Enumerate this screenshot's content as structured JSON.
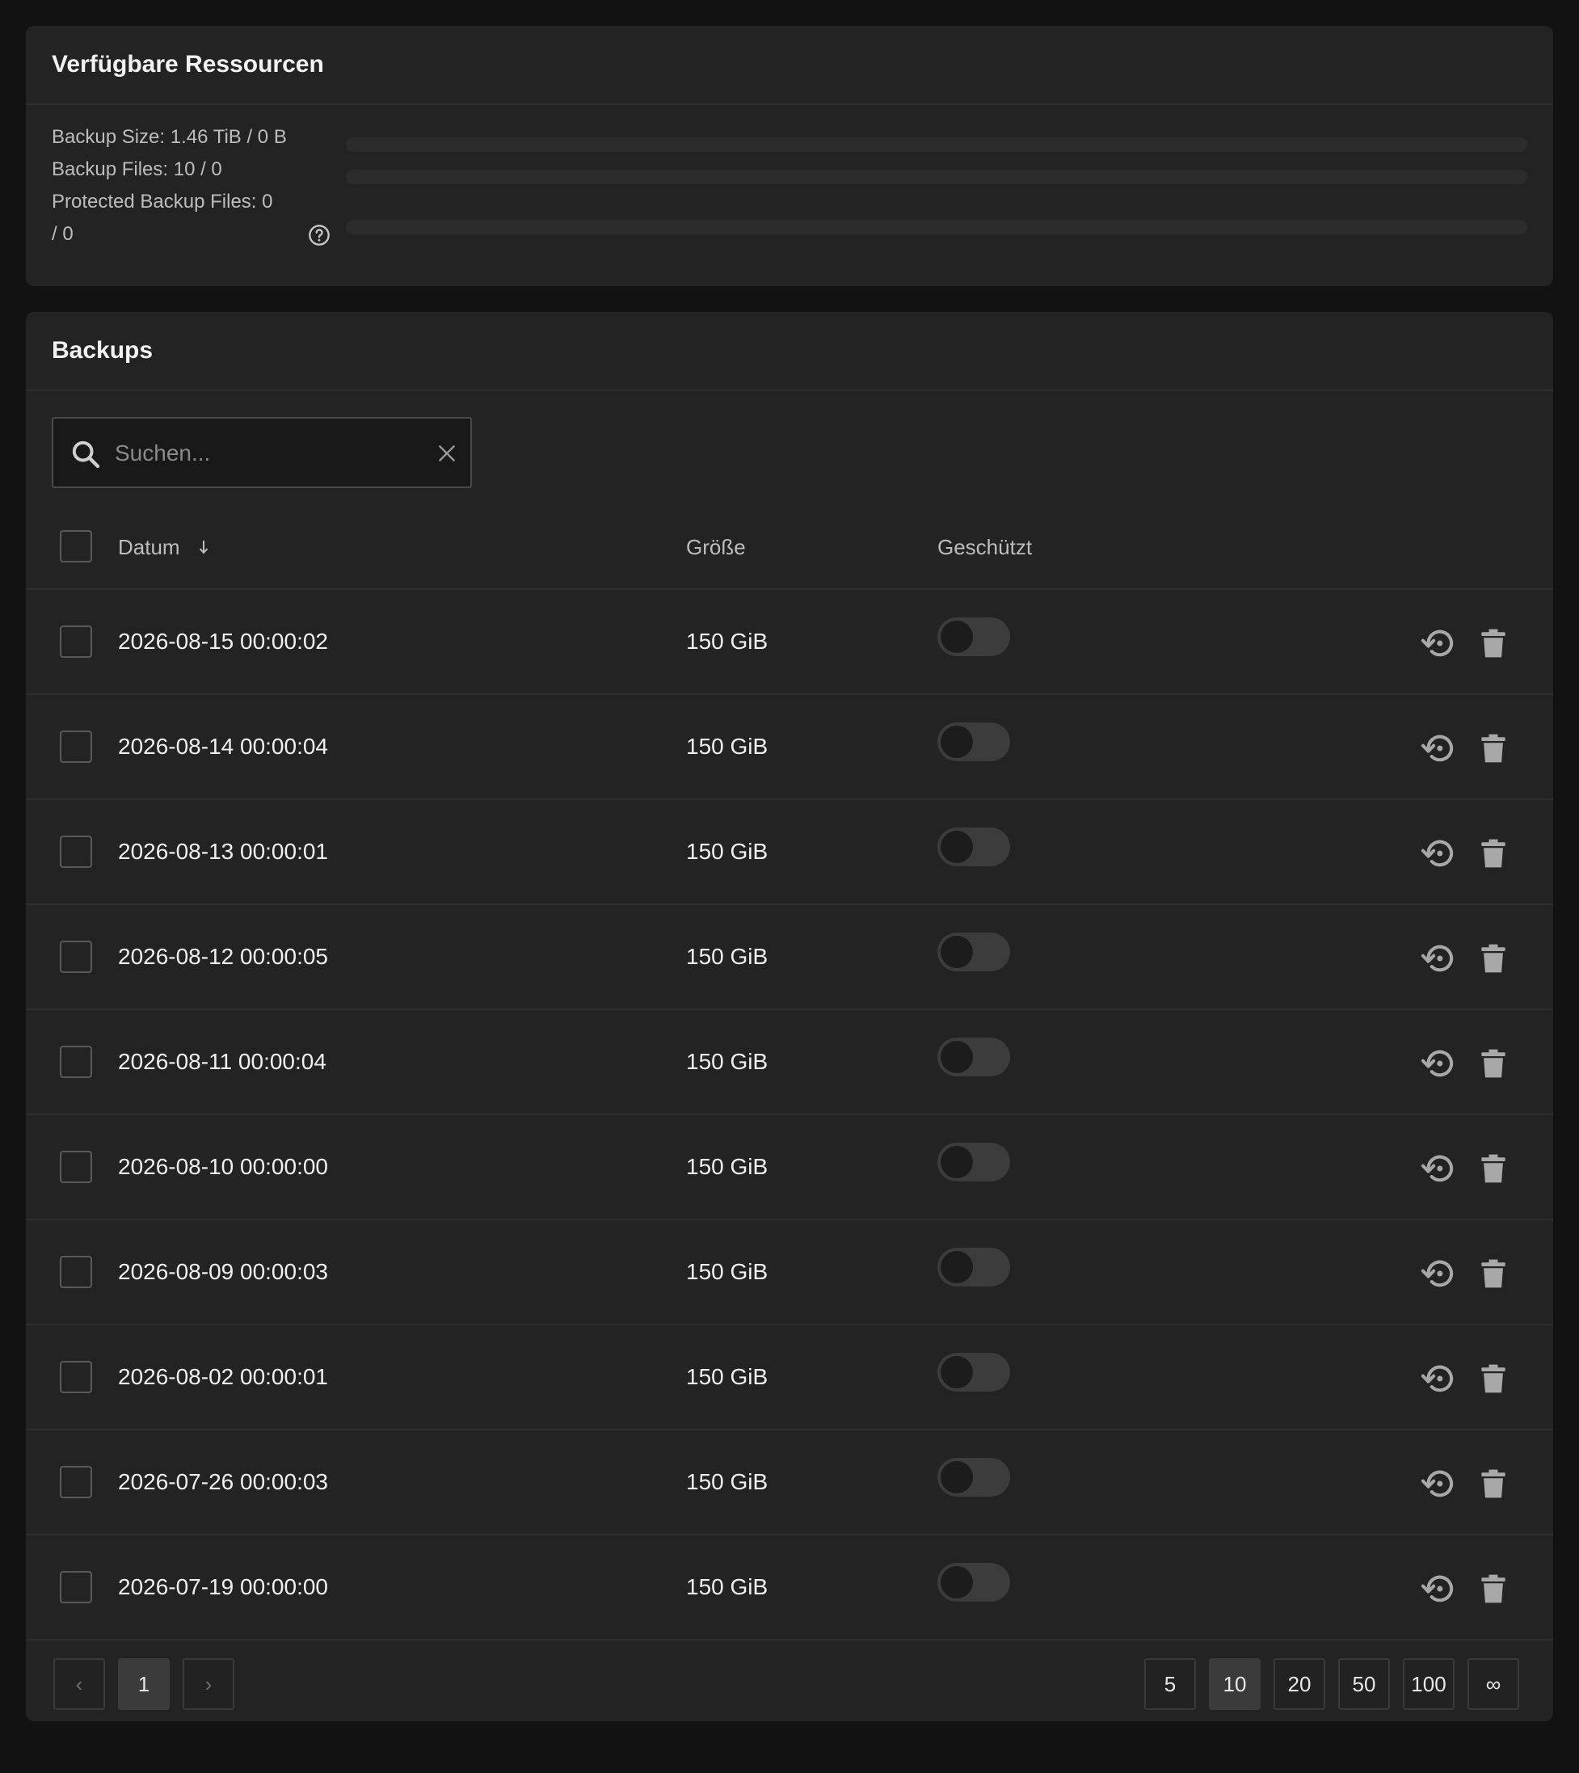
{
  "resources": {
    "title": "Verfügbare Ressourcen",
    "backup_size": "Backup Size: 1.46 TiB / 0 B",
    "backup_size_fill": 0,
    "backup_files": "Backup Files: 10 / 0",
    "backup_files_fill": 0,
    "protected_line1": "Protected Backup Files: 0",
    "protected_line2": "/ 0",
    "protected_fill": 0
  },
  "backups": {
    "title": "Backups",
    "search_placeholder": "Suchen...",
    "columns": {
      "date": "Datum",
      "size": "Größe",
      "protected": "Geschützt"
    },
    "rows": [
      {
        "date": "2026-08-15 00:00:02",
        "size": "150 GiB",
        "protected": false
      },
      {
        "date": "2026-08-14 00:00:04",
        "size": "150 GiB",
        "protected": false
      },
      {
        "date": "2026-08-13 00:00:01",
        "size": "150 GiB",
        "protected": false
      },
      {
        "date": "2026-08-12 00:00:05",
        "size": "150 GiB",
        "protected": false
      },
      {
        "date": "2026-08-11 00:00:04",
        "size": "150 GiB",
        "protected": false
      },
      {
        "date": "2026-08-10 00:00:00",
        "size": "150 GiB",
        "protected": false
      },
      {
        "date": "2026-08-09 00:00:03",
        "size": "150 GiB",
        "protected": false
      },
      {
        "date": "2026-08-02 00:00:01",
        "size": "150 GiB",
        "protected": false
      },
      {
        "date": "2026-07-26 00:00:03",
        "size": "150 GiB",
        "protected": false
      },
      {
        "date": "2026-07-19 00:00:00",
        "size": "150 GiB",
        "protected": false
      }
    ],
    "pagination": {
      "prev": "‹",
      "next": "›",
      "current_page": "1",
      "page_sizes": [
        "5",
        "10",
        "20",
        "50",
        "100",
        "∞"
      ],
      "active_page_size": "10"
    }
  },
  "icons": {
    "help": "help-circle-icon",
    "search": "search-icon",
    "clear": "close-icon",
    "sort": "arrow-down-icon",
    "restore": "restore-icon",
    "delete": "trash-icon"
  },
  "colors": {
    "background": "#121212",
    "card": "#232323",
    "toggle_track": "#3c3c3c",
    "icon": "#a8a8a8"
  }
}
